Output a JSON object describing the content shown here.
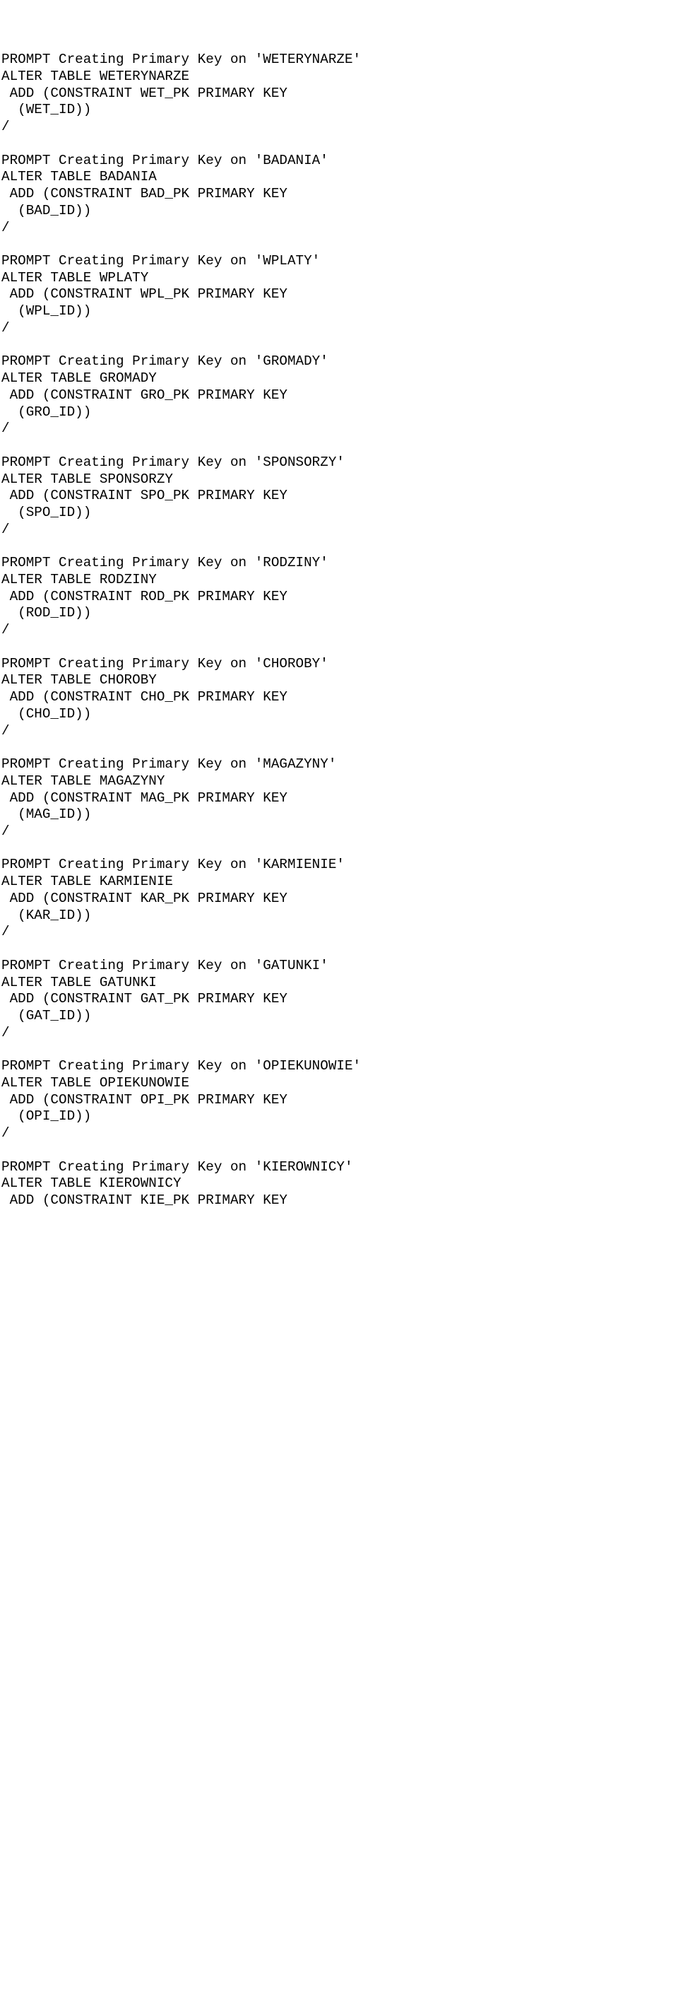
{
  "blocks": [
    {
      "prompt": "PROMPT Creating Primary Key on 'WETERYNARZE'",
      "alter": "ALTER TABLE WETERYNARZE",
      "add": " ADD (CONSTRAINT WET_PK PRIMARY KEY",
      "col": "  (WET_ID))",
      "slash": "/"
    },
    {
      "prompt": "PROMPT Creating Primary Key on 'BADANIA'",
      "alter": "ALTER TABLE BADANIA",
      "add": " ADD (CONSTRAINT BAD_PK PRIMARY KEY",
      "col": "  (BAD_ID))",
      "slash": "/"
    },
    {
      "prompt": "PROMPT Creating Primary Key on 'WPLATY'",
      "alter": "ALTER TABLE WPLATY",
      "add": " ADD (CONSTRAINT WPL_PK PRIMARY KEY",
      "col": "  (WPL_ID))",
      "slash": "/"
    },
    {
      "prompt": "PROMPT Creating Primary Key on 'GROMADY'",
      "alter": "ALTER TABLE GROMADY",
      "add": " ADD (CONSTRAINT GRO_PK PRIMARY KEY",
      "col": "  (GRO_ID))",
      "slash": "/"
    },
    {
      "prompt": "PROMPT Creating Primary Key on 'SPONSORZY'",
      "alter": "ALTER TABLE SPONSORZY",
      "add": " ADD (CONSTRAINT SPO_PK PRIMARY KEY",
      "col": "  (SPO_ID))",
      "slash": "/"
    },
    {
      "prompt": "PROMPT Creating Primary Key on 'RODZINY'",
      "alter": "ALTER TABLE RODZINY",
      "add": " ADD (CONSTRAINT ROD_PK PRIMARY KEY",
      "col": "  (ROD_ID))",
      "slash": "/"
    },
    {
      "prompt": "PROMPT Creating Primary Key on 'CHOROBY'",
      "alter": "ALTER TABLE CHOROBY",
      "add": " ADD (CONSTRAINT CHO_PK PRIMARY KEY",
      "col": "  (CHO_ID))",
      "slash": "/"
    },
    {
      "prompt": "PROMPT Creating Primary Key on 'MAGAZYNY'",
      "alter": "ALTER TABLE MAGAZYNY",
      "add": " ADD (CONSTRAINT MAG_PK PRIMARY KEY",
      "col": "  (MAG_ID))",
      "slash": "/"
    },
    {
      "prompt": "PROMPT Creating Primary Key on 'KARMIENIE'",
      "alter": "ALTER TABLE KARMIENIE",
      "add": " ADD (CONSTRAINT KAR_PK PRIMARY KEY",
      "col": "  (KAR_ID))",
      "slash": "/"
    },
    {
      "prompt": "PROMPT Creating Primary Key on 'GATUNKI'",
      "alter": "ALTER TABLE GATUNKI",
      "add": " ADD (CONSTRAINT GAT_PK PRIMARY KEY",
      "col": "  (GAT_ID))",
      "slash": "/"
    },
    {
      "prompt": "PROMPT Creating Primary Key on 'OPIEKUNOWIE'",
      "alter": "ALTER TABLE OPIEKUNOWIE",
      "add": " ADD (CONSTRAINT OPI_PK PRIMARY KEY",
      "col": "  (OPI_ID))",
      "slash": "/"
    },
    {
      "prompt": "PROMPT Creating Primary Key on 'KIEROWNICY'",
      "alter": "ALTER TABLE KIEROWNICY",
      "add": " ADD (CONSTRAINT KIE_PK PRIMARY KEY"
    }
  ]
}
